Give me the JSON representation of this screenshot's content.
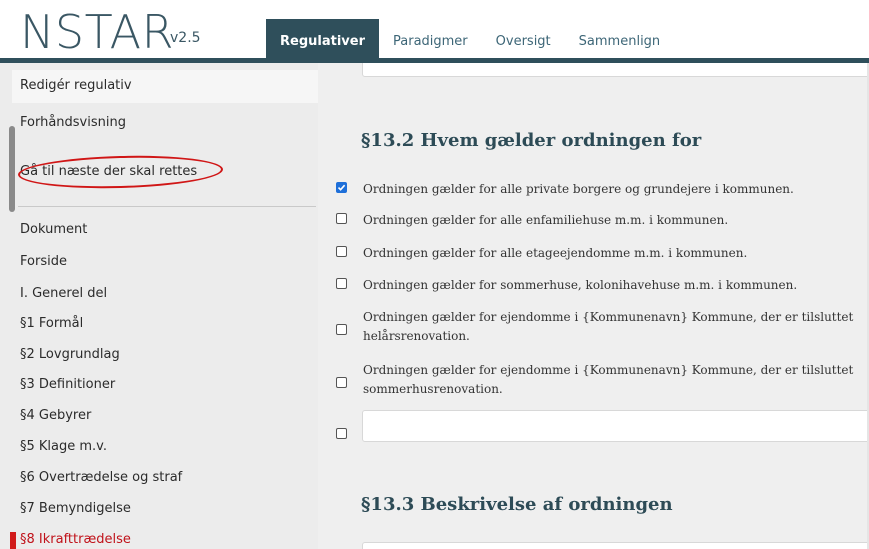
{
  "app": {
    "name": "NSTAR",
    "version": "v2.5"
  },
  "tabs": [
    {
      "label": "Regulativer",
      "active": true
    },
    {
      "label": "Paradigmer",
      "active": false
    },
    {
      "label": "Oversigt",
      "active": false
    },
    {
      "label": "Sammenlign",
      "active": false
    }
  ],
  "sidebar": {
    "actions": [
      {
        "label": "Redigér regulativ"
      },
      {
        "label": "Forhåndsvisning"
      },
      {
        "label": "Gå til næste der skal rettes"
      }
    ],
    "items": [
      {
        "label": "Dokument"
      },
      {
        "label": "Forside"
      },
      {
        "label": "I. Generel del"
      },
      {
        "label": "§1 Formål"
      },
      {
        "label": "§2 Lovgrundlag"
      },
      {
        "label": "§3 Definitioner"
      },
      {
        "label": "§4 Gebyrer"
      },
      {
        "label": "§5 Klage m.v."
      },
      {
        "label": "§6 Overtrædelse og straf"
      },
      {
        "label": "§7 Bemyndigelse"
      },
      {
        "label": "§8 Ikrafttrædelse",
        "active": true
      }
    ],
    "active_color": "#d11a1a"
  },
  "main": {
    "section_132": {
      "heading": "§13.2 Hvem gælder ordningen for",
      "options": [
        {
          "text": "Ordningen gælder for alle private borgere og grundejere i kommunen.",
          "checked": true
        },
        {
          "text": "Ordningen gælder for alle enfamiliehuse m.m. i kommunen.",
          "checked": false
        },
        {
          "text": "Ordningen gælder for alle etageejendomme m.m. i kommunen.",
          "checked": false
        },
        {
          "text": "Ordningen gælder for sommerhuse, kolonihavehuse m.m. i kommunen.",
          "checked": false
        },
        {
          "text": "Ordningen gælder for ejendomme i {Kommunenavn} Kommune, der er tilsluttet helårsrenovation.",
          "checked": false
        },
        {
          "text": "Ordningen gælder for ejendomme i {Kommunenavn} Kommune, der er tilsluttet sommerhusrenovation.",
          "checked": false
        }
      ],
      "custom_option_value": ""
    },
    "section_133": {
      "heading": "§13.3 Beskrivelse af ordningen"
    }
  },
  "colors": {
    "accent": "#2f4f5b",
    "checkbox_checked": "#1e6fd9",
    "annotation_circle": "#d01616"
  }
}
